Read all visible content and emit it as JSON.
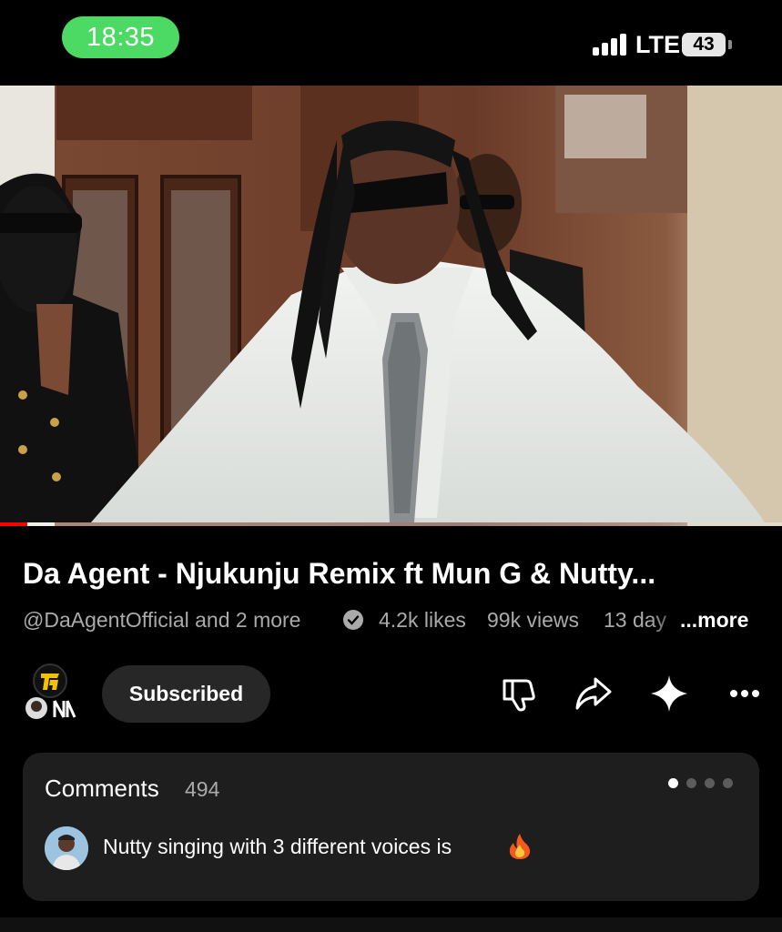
{
  "status_bar": {
    "time": "18:35",
    "network": "LTE",
    "battery": "43",
    "colors": {
      "time_pill": "#4cd964"
    }
  },
  "video": {
    "progress_fraction": 0.035,
    "colors": {
      "progress": "#ff0000"
    }
  },
  "title": "Da Agent - Njukunju Remix ft Mun G & Nutty...",
  "meta": {
    "channel": "@DaAgentOfficial and 2 more",
    "likes": "4.2k likes",
    "views": "99k views",
    "ago": "13 day",
    "more": "...more"
  },
  "actions": {
    "subscribe_label": "Subscribed",
    "icons": [
      "dislike-icon",
      "share-icon",
      "sparkle-icon",
      "more-icon"
    ]
  },
  "comments": {
    "title": "Comments",
    "count": "494",
    "top_comment": "Nutty singing with 3 different voices is",
    "emoji": "fire-icon",
    "carousel_pages": 4,
    "carousel_active": 0
  }
}
